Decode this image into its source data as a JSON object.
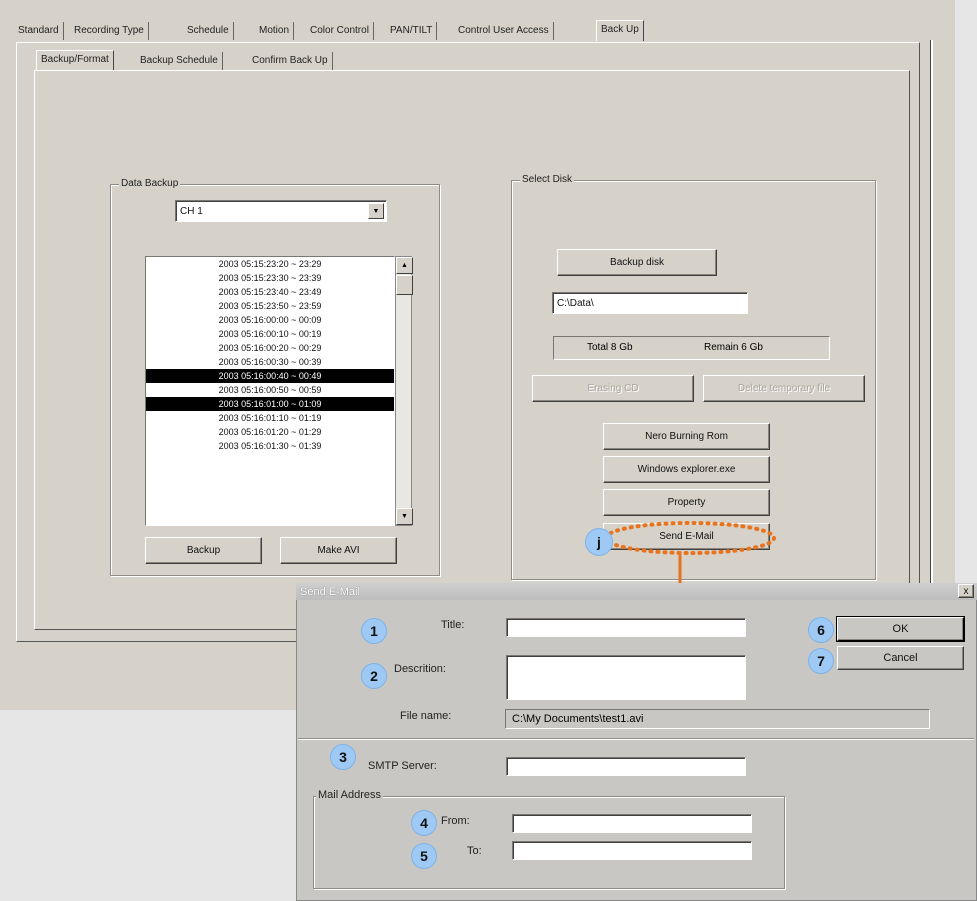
{
  "tabs": [
    "Standard",
    "Recording Type",
    "Schedule",
    "Motion",
    "Color Control",
    "PAN/TILT",
    "Control User Access",
    "Back Up"
  ],
  "active_tab": "Back Up",
  "subtabs": [
    "Backup/Format",
    "Backup Schedule",
    "Confirm Back Up"
  ],
  "data_backup": {
    "label": "Data Backup",
    "channel": "CH 1",
    "list": [
      {
        "text": "2003 05:15:23:20 ~ 23:29",
        "selected": false
      },
      {
        "text": "2003 05:15:23:30 ~ 23:39",
        "selected": false
      },
      {
        "text": "2003 05:15:23:40 ~ 23:49",
        "selected": false
      },
      {
        "text": "2003 05:15:23:50 ~ 23:59",
        "selected": false
      },
      {
        "text": "2003 05:16:00:00 ~ 00:09",
        "selected": false
      },
      {
        "text": "2003 05:16:00:10 ~ 00:19",
        "selected": false
      },
      {
        "text": "2003 05:16:00:20 ~ 00:29",
        "selected": false
      },
      {
        "text": "2003 05:16:00:30 ~ 00:39",
        "selected": false
      },
      {
        "text": "2003 05:16:00:40 ~ 00:49",
        "selected": true
      },
      {
        "text": "2003 05:16:00:50 ~ 00:59",
        "selected": false
      },
      {
        "text": "2003 05:16:01:00 ~ 01:09",
        "selected": true
      },
      {
        "text": "2003 05:16:01:10 ~ 01:19",
        "selected": false
      },
      {
        "text": "2003 05:16:01:20 ~ 01:29",
        "selected": false
      },
      {
        "text": "2003 05:16:01:30 ~ 01:39",
        "selected": false
      }
    ],
    "backup_label": "Backup",
    "make_avi_label": "Make AVI"
  },
  "select_disk": {
    "label": "Select Disk",
    "backup_disk_label": "Backup disk",
    "path": "C:\\Data\\",
    "total": "Total 8 Gb",
    "remain": "Remain 6 Gb",
    "erasing_cd_label": "Erasing CD",
    "delete_temp_label": "Delete temporary file",
    "nero_label": "Nero Burning Rom",
    "explorer_label": "Windows explorer.exe",
    "property_label": "Property",
    "send_email_label": "Send E-Mail",
    "callout": "j"
  },
  "dialog": {
    "title": "Send E-Mail",
    "close": "x",
    "title_label": "Title:",
    "description_label": "Descrition:",
    "filename_label": "File name:",
    "filename_value": "C:\\My Documents\\test1.avi",
    "smtp_label": "SMTP Server:",
    "mail_address_label": "Mail Address",
    "from_label": "From:",
    "to_label": "To:",
    "ok_label": "OK",
    "cancel_label": "Cancel",
    "badges": [
      "1",
      "2",
      "3",
      "4",
      "5",
      "6",
      "7"
    ]
  },
  "colors": {
    "accent": "#e8731c",
    "badge": "#9ec9f4"
  }
}
